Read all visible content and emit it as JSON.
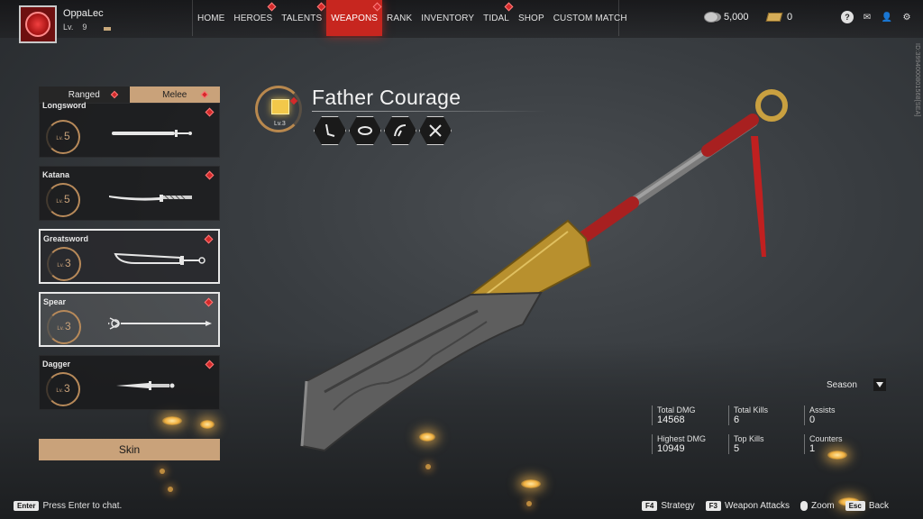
{
  "player": {
    "name": "OppaLec",
    "level_label": "Lv.",
    "level": "9"
  },
  "nav": {
    "items": [
      {
        "label": "HOME",
        "active": false,
        "dot": false
      },
      {
        "label": "HEROES",
        "active": false,
        "dot": true
      },
      {
        "label": "TALENTS",
        "active": false,
        "dot": true
      },
      {
        "label": "WEAPONS",
        "active": true,
        "dot": true
      },
      {
        "label": "RANK",
        "active": false,
        "dot": false
      },
      {
        "label": "INVENTORY",
        "active": false,
        "dot": false
      },
      {
        "label": "TIDAL",
        "active": false,
        "dot": true
      },
      {
        "label": "SHOP",
        "active": false,
        "dot": false
      },
      {
        "label": "CUSTOM MATCH",
        "active": false,
        "dot": false
      }
    ]
  },
  "currency": {
    "coins": "5,000",
    "tickets": "0"
  },
  "server_id": "ID:3994000801568[SEA]",
  "tabs": {
    "ranged": "Ranged",
    "melee": "Melee"
  },
  "weapons": [
    {
      "name": "Longsword",
      "lv": "Lv.",
      "level": "5",
      "icon": "longsword-icon"
    },
    {
      "name": "Katana",
      "lv": "Lv.",
      "level": "5",
      "icon": "katana-icon"
    },
    {
      "name": "Greatsword",
      "lv": "Lv.",
      "level": "3",
      "icon": "greatsword-icon"
    },
    {
      "name": "Spear",
      "lv": "Lv.",
      "level": "3",
      "icon": "spear-icon"
    },
    {
      "name": "Dagger",
      "lv": "Lv.",
      "level": "3",
      "icon": "dagger-icon"
    }
  ],
  "skin_button": "Skin",
  "weapon": {
    "title": "Father Courage",
    "level": "Lv.3",
    "skills": [
      "skill-slash-icon",
      "skill-spin-icon",
      "skill-arc-icon",
      "skill-cross-icon"
    ]
  },
  "season": "Season",
  "stats": {
    "total_dmg_label": "Total DMG",
    "total_dmg": "14568",
    "total_kills_label": "Total Kills",
    "total_kills": "6",
    "assists_label": "Assists",
    "assists": "0",
    "highest_dmg_label": "Highest DMG",
    "highest_dmg": "10949",
    "top_kills_label": "Top Kills",
    "top_kills": "5",
    "counters_label": "Counters",
    "counters": "1"
  },
  "chat": {
    "key": "Enter",
    "text": "Press Enter to chat."
  },
  "hints": [
    {
      "key": "F4",
      "label": "Strategy"
    },
    {
      "key": "F3",
      "label": "Weapon Attacks"
    },
    {
      "key": "",
      "label": "Zoom"
    },
    {
      "key": "Esc",
      "label": "Back"
    }
  ],
  "colors": {
    "accent_red": "#c7261f",
    "tan": "#c9a27a",
    "gold": "#d6ad58"
  }
}
